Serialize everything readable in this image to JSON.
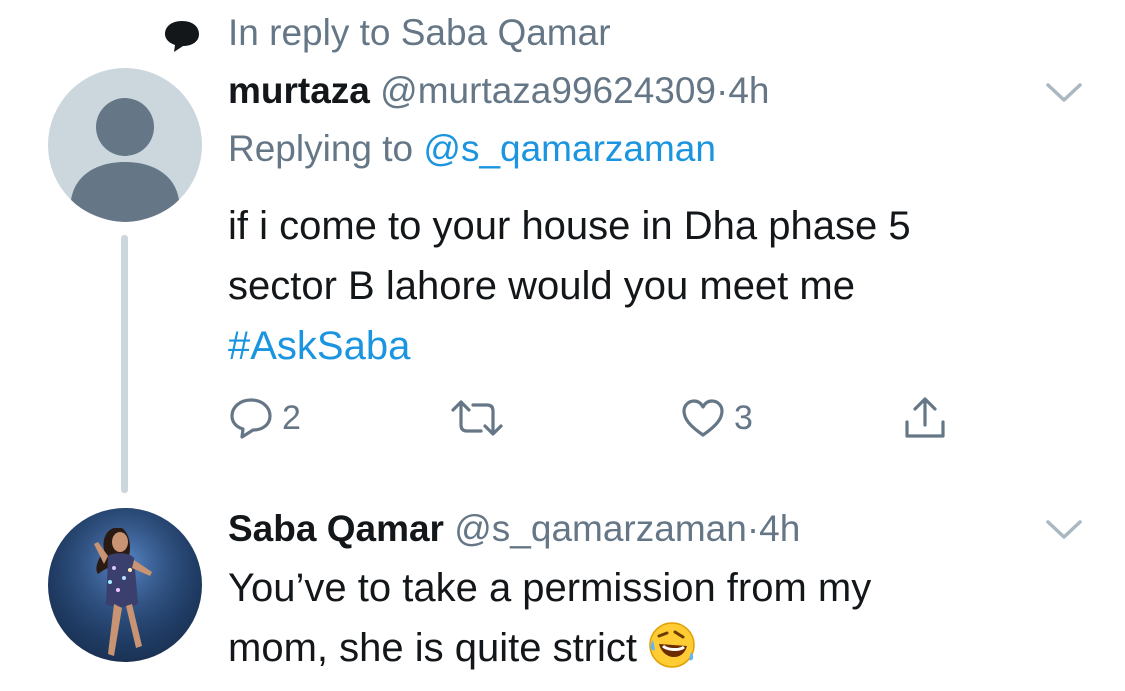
{
  "context": {
    "reply_to_text": "In reply to Saba Qamar",
    "icon": "speech-bubble-icon"
  },
  "reply_tweet": {
    "name": "murtaza",
    "handle": "@murtaza99624309",
    "separator": "·",
    "time": "4h",
    "replying_prefix": "Replying to",
    "replying_handle": "@s_qamarzaman",
    "text_line1": "if i come to your house in Dha phase 5",
    "text_line2": "sector B  lahore would you meet me",
    "hashtag": "#AskSaba",
    "avatar": "default-avatar-icon",
    "actions": {
      "reply_count": "2",
      "retweet_count": "",
      "like_count": "3"
    }
  },
  "answer_tweet": {
    "name": "Saba Qamar",
    "handle": "@s_qamarzaman",
    "separator": "·",
    "time": "4h",
    "text_line1": "You’ve to take a permission from my",
    "text_line2": "mom, she is quite strict",
    "emoji": "rolling-on-floor-laughing-emoji",
    "avatar": "profile-photo"
  },
  "colors": {
    "text": "#14171a",
    "secondary": "#657786",
    "link": "#1b95e0",
    "avatar_bg": "#ccd6dd",
    "avatar_fg": "#657786"
  }
}
